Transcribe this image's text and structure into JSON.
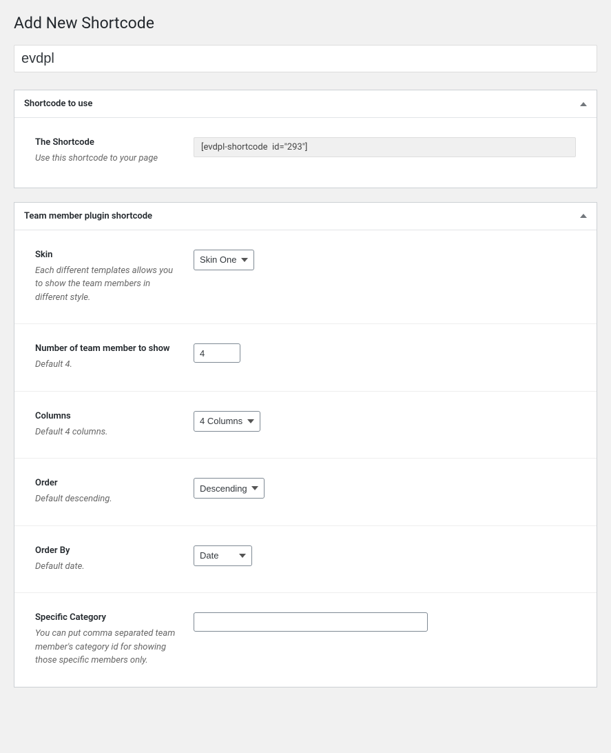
{
  "page": {
    "title": "Add New Shortcode",
    "title_input_value": "evdpl"
  },
  "box1": {
    "title": "Shortcode to use",
    "field": {
      "label": "The Shortcode",
      "desc": "Use this shortcode to your page",
      "value": "[evdpl-shortcode  id=\"293\"]"
    }
  },
  "box2": {
    "title": "Team member plugin shortcode",
    "fields": {
      "skin": {
        "label": "Skin",
        "desc": "Each different templates allows you to show the team members in different style.",
        "selected": "Skin One"
      },
      "count": {
        "label": "Number of team member to show",
        "desc": "Default 4.",
        "value": "4"
      },
      "columns": {
        "label": "Columns",
        "desc": "Default 4 columns.",
        "selected": "4 Columns"
      },
      "order": {
        "label": "Order",
        "desc": "Default descending.",
        "selected": "Descending"
      },
      "orderby": {
        "label": "Order By",
        "desc": "Default date.",
        "selected": "Date"
      },
      "category": {
        "label": "Specific Category",
        "desc": "You can put comma separated team member's category id for showing those specific members only.",
        "value": ""
      }
    }
  }
}
